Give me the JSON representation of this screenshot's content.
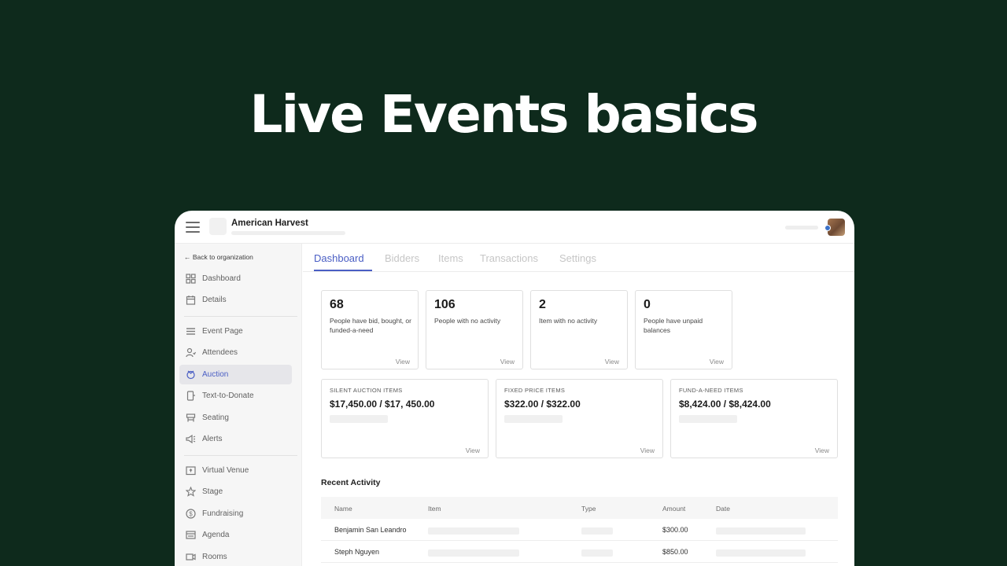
{
  "hero": {
    "title": "Live Events basics"
  },
  "header": {
    "org_name": "American Harvest"
  },
  "sidebar": {
    "back_label": "← Back to organization",
    "items": [
      {
        "label": "Dashboard",
        "icon": "dashboard-icon"
      },
      {
        "label": "Details",
        "icon": "calendar-icon"
      },
      {
        "label": "Event Page",
        "icon": "list-icon"
      },
      {
        "label": "Attendees",
        "icon": "attendees-icon"
      },
      {
        "label": "Auction",
        "icon": "auction-icon",
        "active": true
      },
      {
        "label": "Text-to-Donate",
        "icon": "phone-icon"
      },
      {
        "label": "Seating",
        "icon": "seating-icon"
      },
      {
        "label": "Alerts",
        "icon": "megaphone-icon"
      },
      {
        "label": "Virtual Venue",
        "icon": "venue-icon"
      },
      {
        "label": "Stage",
        "icon": "star-icon"
      },
      {
        "label": "Fundraising",
        "icon": "dollar-icon"
      },
      {
        "label": "Agenda",
        "icon": "agenda-icon"
      },
      {
        "label": "Rooms",
        "icon": "rooms-icon"
      }
    ]
  },
  "tabs": [
    {
      "label": "Dashboard",
      "active": true
    },
    {
      "label": "Bidders"
    },
    {
      "label": "Items"
    },
    {
      "label": "Transactions"
    },
    {
      "label": "Settings"
    }
  ],
  "stats": [
    {
      "value": "68",
      "label": "People have bid, bought, or funded-a-need",
      "link": "View"
    },
    {
      "value": "106",
      "label": "People with no activity",
      "link": "View"
    },
    {
      "value": "2",
      "label": "Item with no activity",
      "link": "View"
    },
    {
      "value": "0",
      "label": "People have unpaid balances",
      "link": "View"
    }
  ],
  "summaries": [
    {
      "label": "SILENT AUCTION ITEMS",
      "value": "$17,450.00 / $17, 450.00",
      "link": "View"
    },
    {
      "label": "FIXED PRICE ITEMS",
      "value": "$322.00 / $322.00",
      "link": "View"
    },
    {
      "label": "FUND-A-NEED ITEMS",
      "value": "$8,424.00 / $8,424.00",
      "link": "View"
    }
  ],
  "recent_activity": {
    "title": "Recent Activity",
    "columns": [
      "Name",
      "Item",
      "Type",
      "Amount",
      "Date"
    ],
    "rows": [
      {
        "name": "Benjamin San Leandro",
        "amount": "$300.00"
      },
      {
        "name": "Steph Nguyen",
        "amount": "$850.00"
      }
    ]
  },
  "colors": {
    "background": "#0e2a1c",
    "accent": "#4a5ec4"
  }
}
